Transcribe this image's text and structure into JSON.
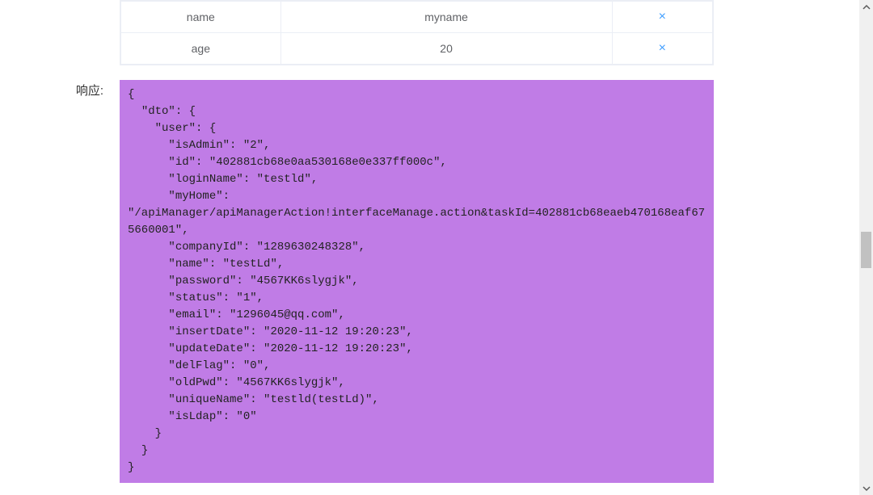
{
  "table": {
    "rows": [
      {
        "key": "name",
        "value": "myname",
        "action": "×"
      },
      {
        "key": "age",
        "value": "20",
        "action": "×"
      }
    ]
  },
  "response": {
    "label": "响应:",
    "body": "{\n  \"dto\": {\n    \"user\": {\n      \"isAdmin\": \"2\",\n      \"id\": \"402881cb68e0aa530168e0e337ff000c\",\n      \"loginName\": \"testld\",\n      \"myHome\": \"/apiManager/apiManagerAction!interfaceManage.action&taskId=402881cb68eaeb470168eaf675660001\",\n      \"companyId\": \"1289630248328\",\n      \"name\": \"testLd\",\n      \"password\": \"4567KK6slygjk\",\n      \"status\": \"1\",\n      \"email\": \"1296045@qq.com\",\n      \"insertDate\": \"2020-11-12 19:20:23\",\n      \"updateDate\": \"2020-11-12 19:20:23\",\n      \"delFlag\": \"0\",\n      \"oldPwd\": \"4567KK6slygjk\",\n      \"uniqueName\": \"testld(testLd)\",\n      \"isLdap\": \"0\"\n    }\n  }\n}"
  },
  "colors": {
    "responseBg": "#c07ce6",
    "tableBorder": "#ebeef5",
    "deleteIcon": "#409eff"
  }
}
